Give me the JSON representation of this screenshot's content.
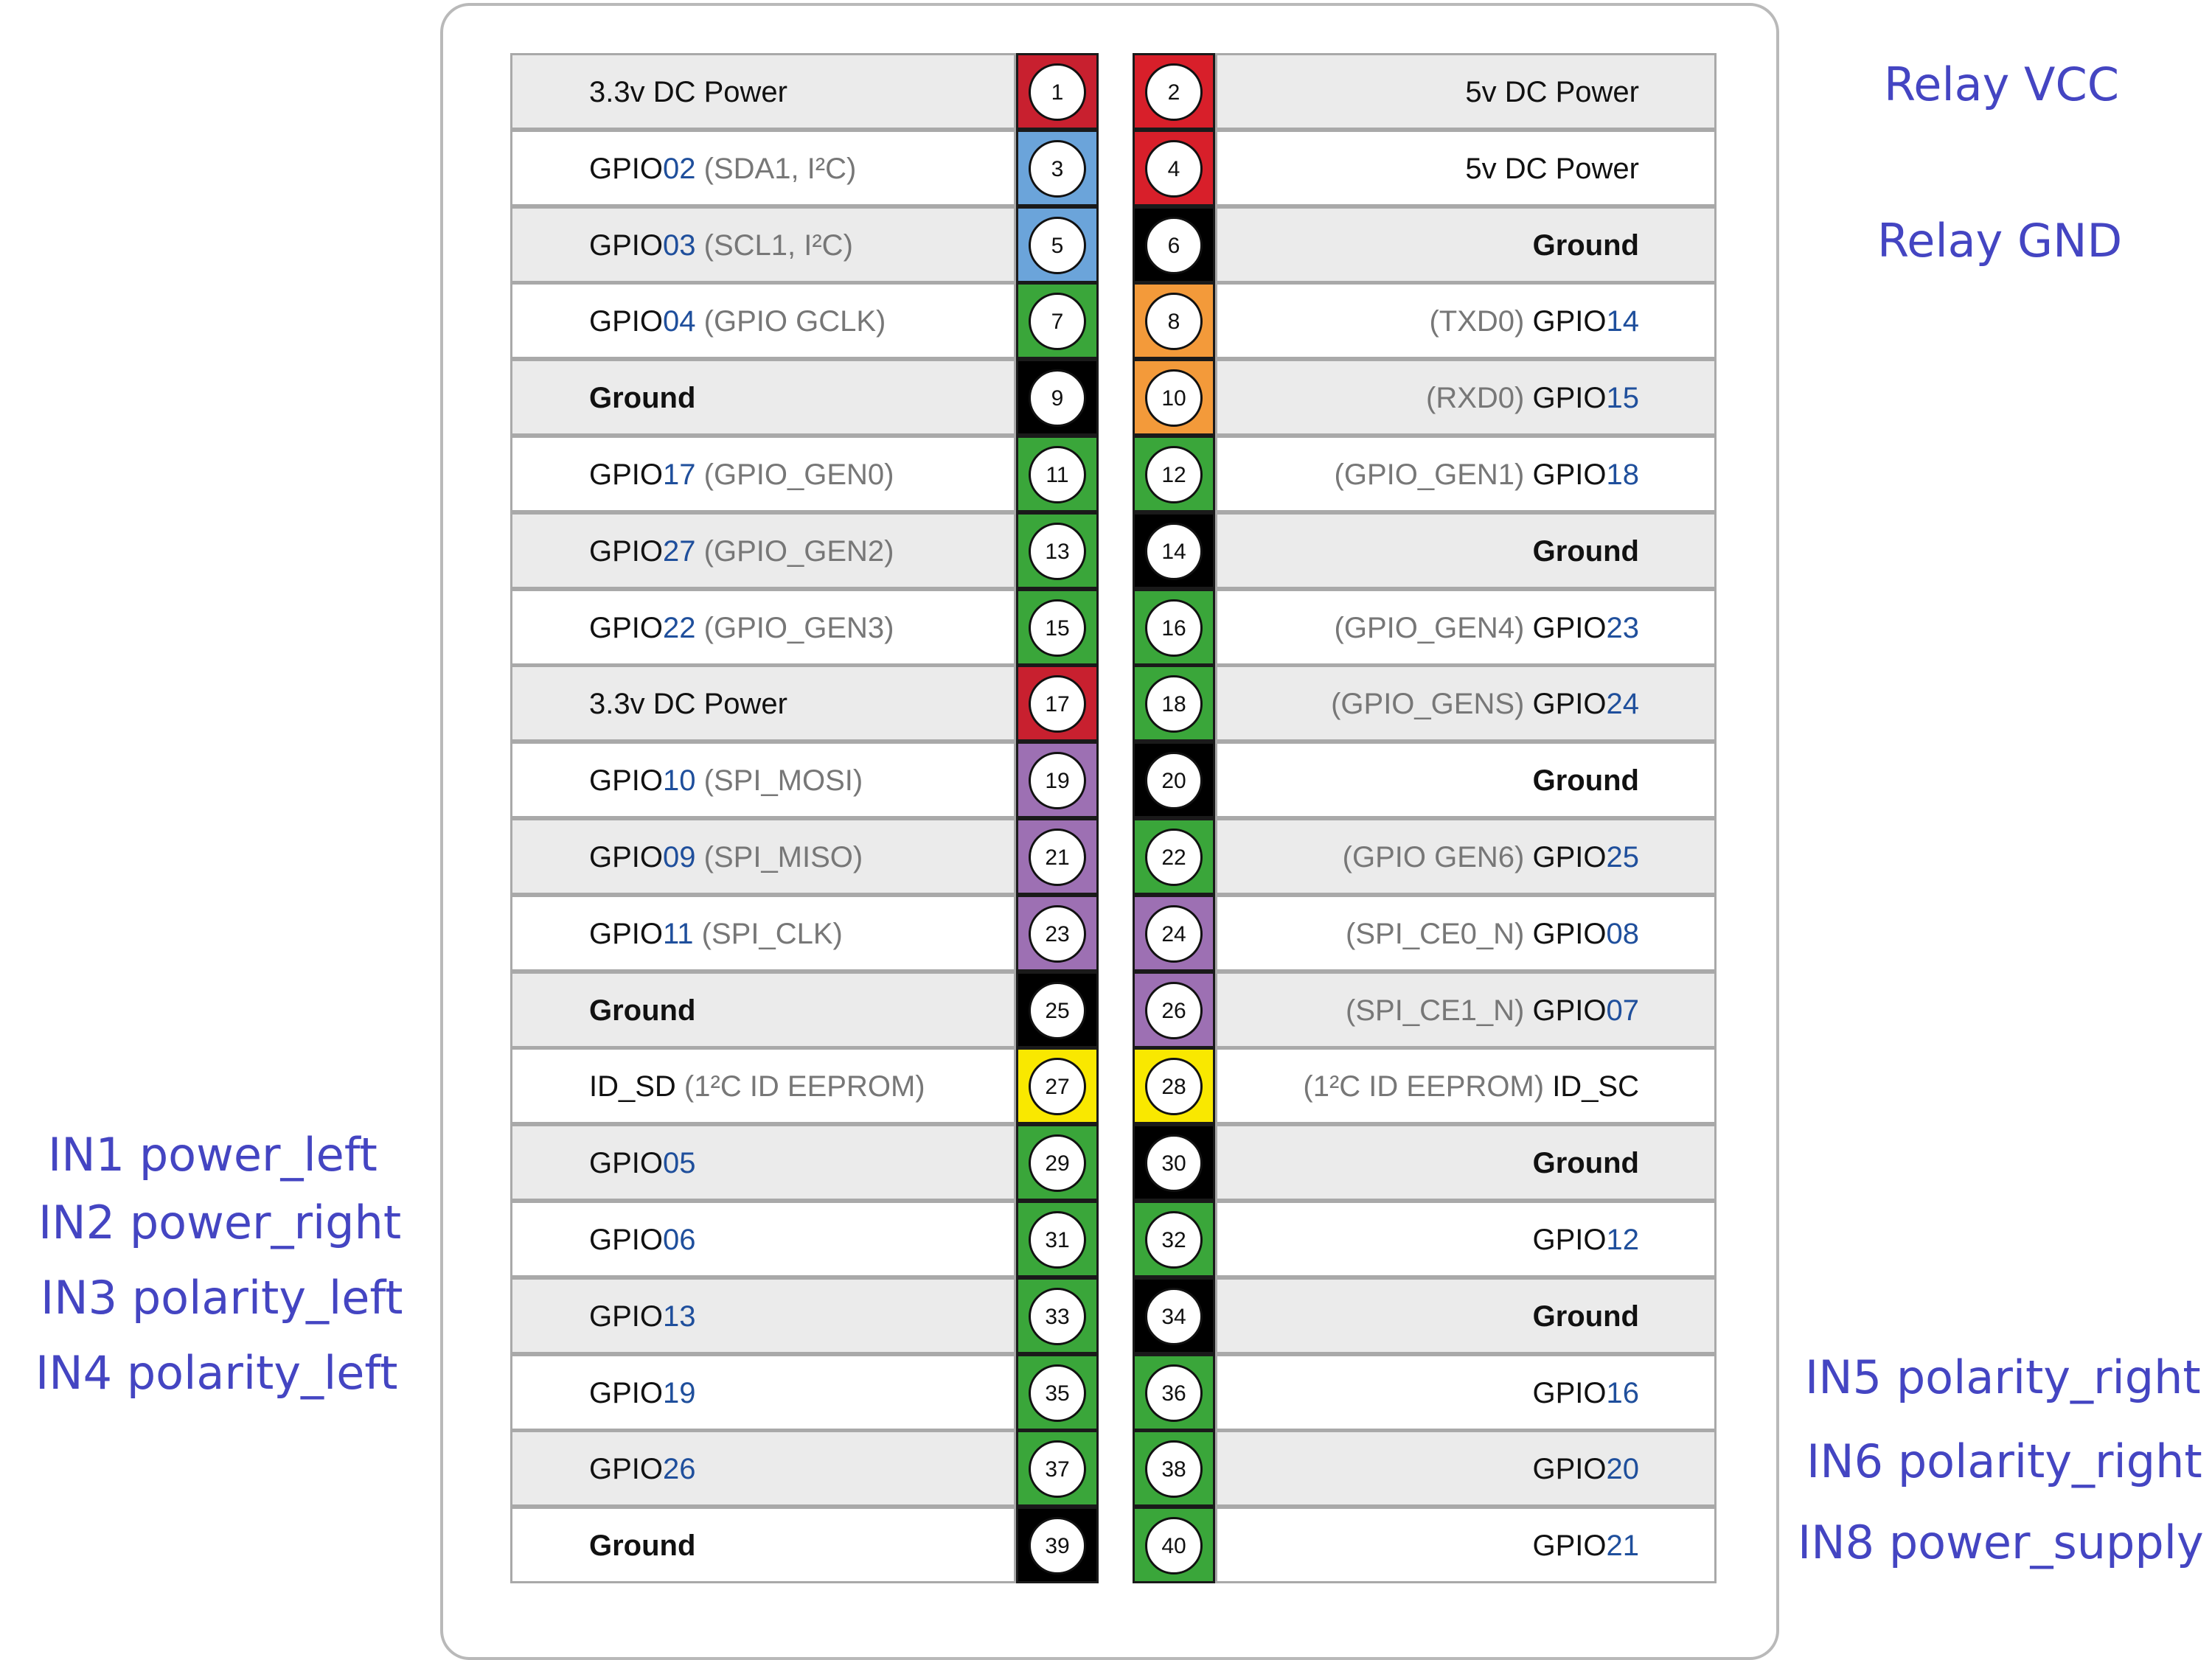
{
  "colors": {
    "power_3v3": "#c8202f",
    "power_5v": "#d81f2a",
    "i2c": "#6ba4da",
    "gpio": "#3aa63a",
    "ground": "#000000",
    "uart": "#f39a3a",
    "spi": "#9d70b3",
    "eeprom": "#f9e800",
    "gpio_number": "#1f4f9c",
    "annotation": "#4445c2"
  },
  "rows": [
    {
      "left": {
        "pin": "1",
        "type": "power_3v3",
        "text": "3.3v DC Power",
        "pre": "",
        "num": "",
        "desc": ""
      },
      "right": {
        "pin": "2",
        "type": "power_5v",
        "text": "5v DC Power",
        "desc": "",
        "pre": "",
        "num": ""
      }
    },
    {
      "left": {
        "pin": "3",
        "type": "i2c",
        "text": "",
        "pre": "GPIO",
        "num": "02",
        "desc": " (SDA1, I²C)"
      },
      "right": {
        "pin": "4",
        "type": "power_5v",
        "text": "5v DC Power",
        "desc": "",
        "pre": "",
        "num": ""
      }
    },
    {
      "left": {
        "pin": "5",
        "type": "i2c",
        "text": "",
        "pre": "GPIO",
        "num": "03",
        "desc": " (SCL1, I²C)"
      },
      "right": {
        "pin": "6",
        "type": "ground",
        "text": "Ground",
        "desc": "",
        "pre": "",
        "num": ""
      }
    },
    {
      "left": {
        "pin": "7",
        "type": "gpio",
        "text": "",
        "pre": "GPIO",
        "num": "04",
        "desc": " (GPIO GCLK)"
      },
      "right": {
        "pin": "8",
        "type": "uart",
        "text": "",
        "desc": "(TXD0) ",
        "pre": "GPIO",
        "num": "14"
      }
    },
    {
      "left": {
        "pin": "9",
        "type": "ground",
        "text": "Ground",
        "pre": "",
        "num": "",
        "desc": ""
      },
      "right": {
        "pin": "10",
        "type": "uart",
        "text": "",
        "desc": "(RXD0) ",
        "pre": "GPIO",
        "num": "15"
      }
    },
    {
      "left": {
        "pin": "11",
        "type": "gpio",
        "text": "",
        "pre": "GPIO",
        "num": "17",
        "desc": " (GPIO_GEN0)"
      },
      "right": {
        "pin": "12",
        "type": "gpio",
        "text": "",
        "desc": "(GPIO_GEN1) ",
        "pre": "GPIO",
        "num": "18"
      }
    },
    {
      "left": {
        "pin": "13",
        "type": "gpio",
        "text": "",
        "pre": "GPIO",
        "num": "27",
        "desc": " (GPIO_GEN2)"
      },
      "right": {
        "pin": "14",
        "type": "ground",
        "text": "Ground",
        "desc": "",
        "pre": "",
        "num": ""
      }
    },
    {
      "left": {
        "pin": "15",
        "type": "gpio",
        "text": "",
        "pre": "GPIO",
        "num": "22",
        "desc": " (GPIO_GEN3)"
      },
      "right": {
        "pin": "16",
        "type": "gpio",
        "text": "",
        "desc": "(GPIO_GEN4) ",
        "pre": "GPIO",
        "num": "23"
      }
    },
    {
      "left": {
        "pin": "17",
        "type": "power_3v3",
        "text": "3.3v DC Power",
        "pre": "",
        "num": "",
        "desc": ""
      },
      "right": {
        "pin": "18",
        "type": "gpio",
        "text": "",
        "desc": "(GPIO_GENS) ",
        "pre": "GPIO",
        "num": "24"
      }
    },
    {
      "left": {
        "pin": "19",
        "type": "spi",
        "text": "",
        "pre": "GPIO",
        "num": "10",
        "desc": " (SPI_MOSI)"
      },
      "right": {
        "pin": "20",
        "type": "ground",
        "text": "Ground",
        "desc": "",
        "pre": "",
        "num": ""
      }
    },
    {
      "left": {
        "pin": "21",
        "type": "spi",
        "text": "",
        "pre": "GPIO",
        "num": "09",
        "desc": " (SPI_MISO)"
      },
      "right": {
        "pin": "22",
        "type": "gpio",
        "text": "",
        "desc": "(GPIO GEN6) ",
        "pre": "GPIO",
        "num": "25"
      }
    },
    {
      "left": {
        "pin": "23",
        "type": "spi",
        "text": "",
        "pre": "GPIO",
        "num": "11",
        "desc": " (SPI_CLK)"
      },
      "right": {
        "pin": "24",
        "type": "spi",
        "text": "",
        "desc": "(SPI_CE0_N) ",
        "pre": "GPIO",
        "num": "08"
      }
    },
    {
      "left": {
        "pin": "25",
        "type": "ground",
        "text": "Ground",
        "pre": "",
        "num": "",
        "desc": ""
      },
      "right": {
        "pin": "26",
        "type": "spi",
        "text": "",
        "desc": "(SPI_CE1_N) ",
        "pre": "GPIO",
        "num": "07"
      }
    },
    {
      "left": {
        "pin": "27",
        "type": "eeprom",
        "text": "",
        "pre": "ID_SD",
        "num": "",
        "desc": " (1²C ID EEPROM)"
      },
      "right": {
        "pin": "28",
        "type": "eeprom",
        "text": "",
        "desc": "(1²C ID EEPROM) ",
        "pre": "ID_SC",
        "num": ""
      }
    },
    {
      "left": {
        "pin": "29",
        "type": "gpio",
        "text": "",
        "pre": "GPIO",
        "num": "05",
        "desc": ""
      },
      "right": {
        "pin": "30",
        "type": "ground",
        "text": "Ground",
        "desc": "",
        "pre": "",
        "num": ""
      }
    },
    {
      "left": {
        "pin": "31",
        "type": "gpio",
        "text": "",
        "pre": "GPIO",
        "num": "06",
        "desc": ""
      },
      "right": {
        "pin": "32",
        "type": "gpio",
        "text": "",
        "desc": "",
        "pre": "GPIO",
        "num": "12"
      }
    },
    {
      "left": {
        "pin": "33",
        "type": "gpio",
        "text": "",
        "pre": "GPIO",
        "num": "13",
        "desc": ""
      },
      "right": {
        "pin": "34",
        "type": "ground",
        "text": "Ground",
        "desc": "",
        "pre": "",
        "num": ""
      }
    },
    {
      "left": {
        "pin": "35",
        "type": "gpio",
        "text": "",
        "pre": "GPIO",
        "num": "19",
        "desc": ""
      },
      "right": {
        "pin": "36",
        "type": "gpio",
        "text": "",
        "desc": "",
        "pre": "GPIO",
        "num": "16"
      }
    },
    {
      "left": {
        "pin": "37",
        "type": "gpio",
        "text": "",
        "pre": "GPIO",
        "num": "26",
        "desc": ""
      },
      "right": {
        "pin": "38",
        "type": "gpio",
        "text": "",
        "desc": "",
        "pre": "GPIO",
        "num": "20"
      }
    },
    {
      "left": {
        "pin": "39",
        "type": "ground",
        "text": "Ground",
        "pre": "",
        "num": "",
        "desc": ""
      },
      "right": {
        "pin": "40",
        "type": "gpio",
        "text": "",
        "desc": "",
        "pre": "GPIO",
        "num": "21"
      }
    }
  ],
  "annotations": {
    "relay_vcc": "Relay VCC",
    "relay_gnd": "Relay GND",
    "in1": "IN1 power_left",
    "in2": "IN2 power_right",
    "in3": "IN3 polarity_left",
    "in4": "IN4 polarity_left",
    "in5": "IN5 polarity_right",
    "in6": "IN6 polarity_right",
    "in8": "IN8 power_supply"
  }
}
